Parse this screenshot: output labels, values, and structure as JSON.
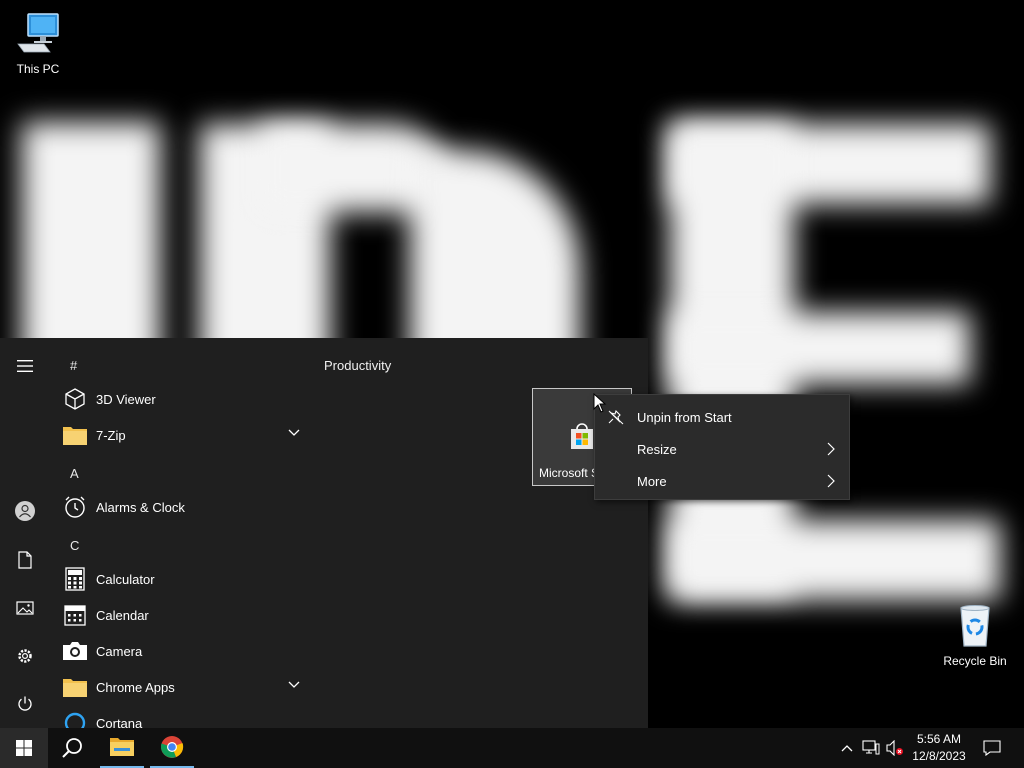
{
  "desktop": {
    "this_pc": "This PC",
    "recycle_bin": "Recycle Bin"
  },
  "start_menu": {
    "list": [
      {
        "type": "header",
        "label": "#"
      },
      {
        "type": "app",
        "label": "3D Viewer",
        "icon": "cube-icon"
      },
      {
        "type": "folder",
        "label": "7-Zip",
        "icon": "folder-icon",
        "expandable": true
      },
      {
        "type": "header",
        "label": "A"
      },
      {
        "type": "app",
        "label": "Alarms & Clock",
        "icon": "clock-icon"
      },
      {
        "type": "header",
        "label": "C"
      },
      {
        "type": "app",
        "label": "Calculator",
        "icon": "calculator-icon"
      },
      {
        "type": "app",
        "label": "Calendar",
        "icon": "calendar-icon"
      },
      {
        "type": "app",
        "label": "Camera",
        "icon": "camera-icon"
      },
      {
        "type": "folder",
        "label": "Chrome Apps",
        "icon": "folder-icon",
        "expandable": true
      },
      {
        "type": "app",
        "label": "Cortana",
        "icon": "cortana-icon"
      }
    ],
    "group_title": "Productivity",
    "tile": {
      "label": "Microsoft Store",
      "icon": "store-icon"
    }
  },
  "context_menu": {
    "items": [
      {
        "label": "Unpin from Start",
        "icon": "unpin-icon",
        "submenu": false
      },
      {
        "label": "Resize",
        "icon": "",
        "submenu": true
      },
      {
        "label": "More",
        "icon": "",
        "submenu": true
      }
    ]
  },
  "taskbar": {
    "time": "5:56 AM",
    "date": "12/8/2023"
  },
  "colors": {
    "start_bg": "#1f1f1f",
    "taskbar_bg": "#101010",
    "context_bg": "#2b2b2b",
    "accent": "#76b9ed",
    "folder": "#f2c14e"
  }
}
